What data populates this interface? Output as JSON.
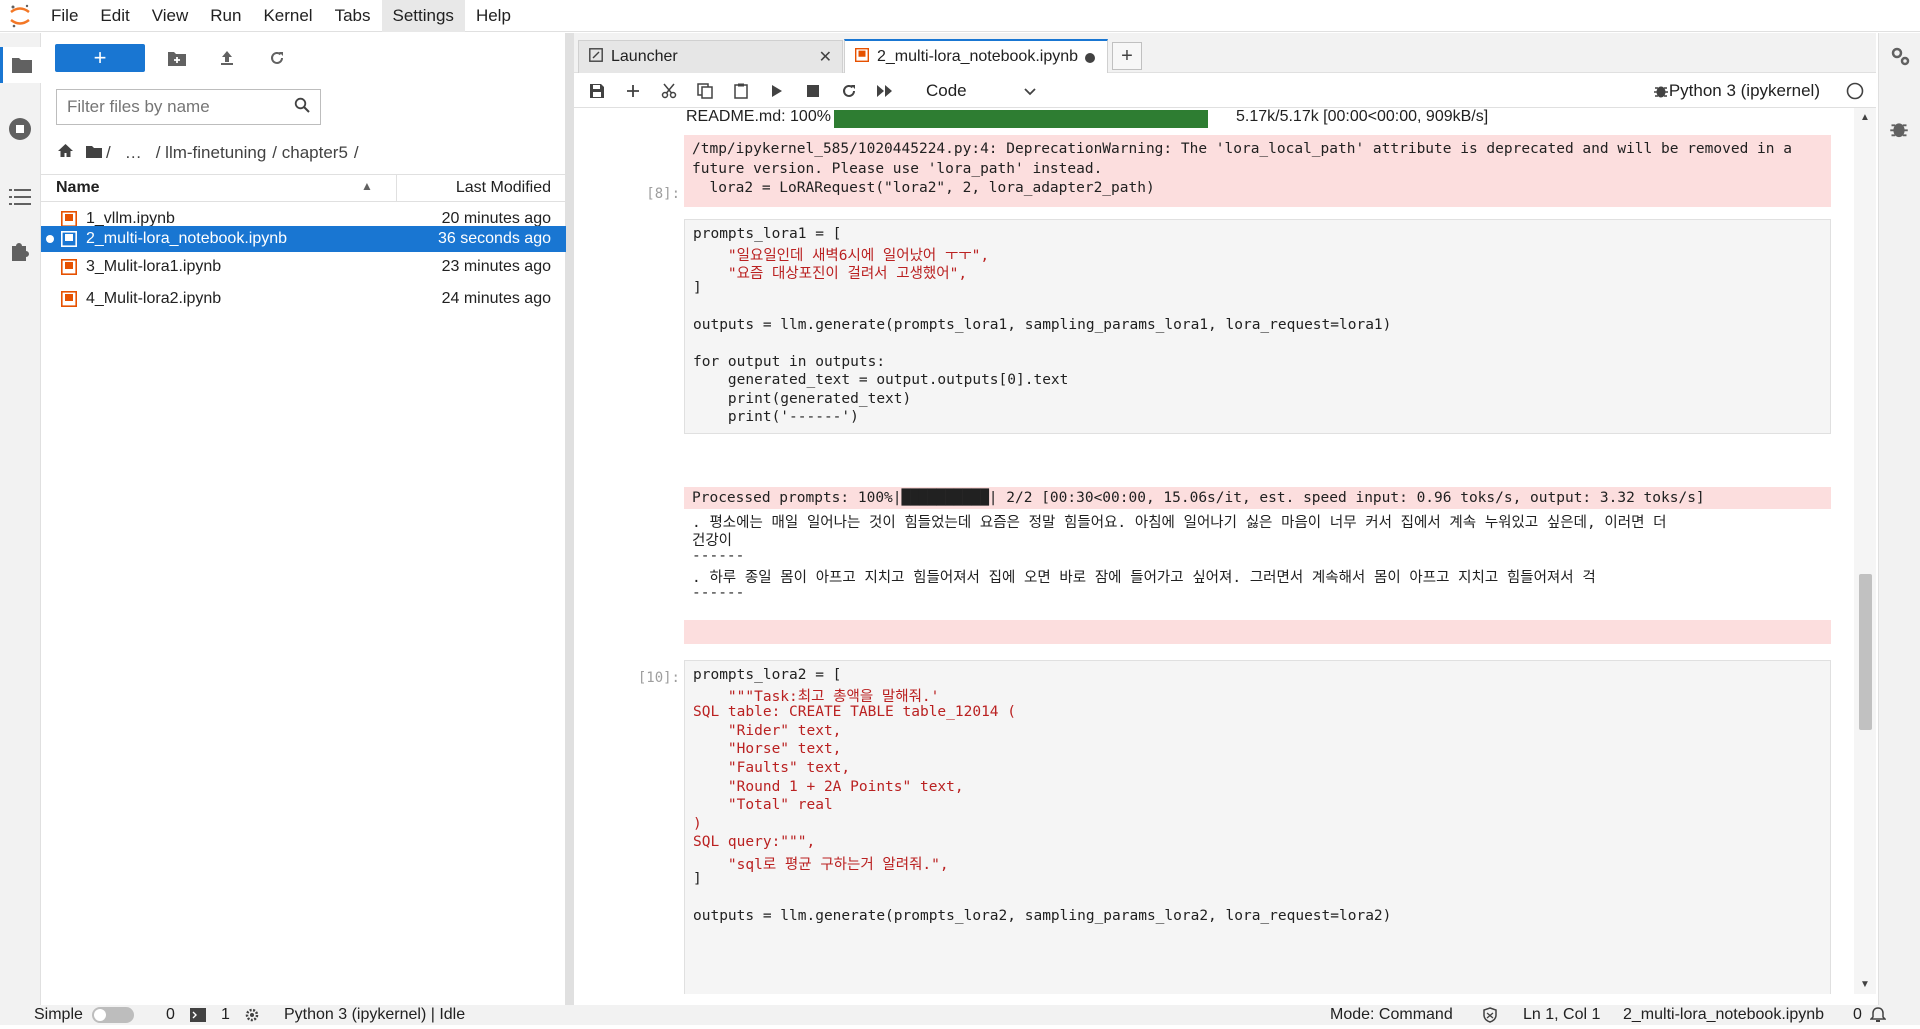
{
  "menubar": {
    "items": [
      "File",
      "Edit",
      "View",
      "Run",
      "Kernel",
      "Tabs",
      "Settings",
      "Help"
    ]
  },
  "filebrowser": {
    "new_button_label": "+",
    "filter_placeholder": "Filter files by name",
    "breadcrumb": [
      "/",
      "…",
      "/ llm-finetuning",
      "/ chapter5",
      "/"
    ],
    "col_name": "Name",
    "col_modified": "Last Modified",
    "files": [
      {
        "name": "1_vllm.ipynb",
        "modified": "20 minutes ago"
      },
      {
        "name": "2_multi-lora_notebook.ipynb",
        "modified": "36 seconds ago"
      },
      {
        "name": "3_Mulit-lora1.ipynb",
        "modified": "23 minutes ago"
      },
      {
        "name": "4_Mulit-lora2.ipynb",
        "modified": "24 minutes ago"
      }
    ]
  },
  "tabs": [
    {
      "label": "Launcher"
    },
    {
      "label": "2_multi-lora_notebook.ipynb"
    }
  ],
  "toolbar": {
    "cell_type": "Code",
    "kernel": "Python 3 (ipykernel)"
  },
  "notebook": {
    "download_line": {
      "left": "README.md: 100%",
      "right": "5.17k/5.17k [00:00<00:00,  909kB/s]"
    },
    "warning_lines": [
      "/tmp/ipykernel_585/1020445224.py:4: DeprecationWarning: The 'lora_local_path' attribute is deprecated and will be removed in a",
      "future version. Please use 'lora_path' instead.",
      "  lora2 = LoRARequest(\"lora2\", 2, lora_adapter2_path)"
    ],
    "cell8": {
      "prompt": "[8]:",
      "lines": [
        "prompts_lora1 = [",
        "    \"일요일인데 새벽6시에 일어났어 ㅜㅜ\",",
        "    \"요즘 대상포진이 걸려서 고생했어\",",
        "]",
        "",
        "outputs = llm.generate(prompts_lora1, sampling_params_lora1, lora_request=lora1)",
        "",
        "for output in outputs:",
        "    generated_text = output.outputs[0].text",
        "    print(generated_text)",
        "    print('------')"
      ]
    },
    "cell8_output": {
      "progress_line": "Processed prompts: 100%|██████████| 2/2 [00:30<00:00, 15.06s/it, est. speed input: 0.96 toks/s, output: 3.32 toks/s]",
      "lines": [
        ". 평소에는 매일 일어나는 것이 힘들었는데 요즘은 정말 힘들어요. 아침에 일어나기 싫은 마음이 너무 커서 집에서 계속 누워있고 싶은데, 이러면 더",
        "건강이",
        "------",
        ". 하루 종일 몸이 아프고 지치고 힘들어져서 집에 오면 바로 잠에 들어가고 싶어져. 그러면서 계속해서 몸이 아프고 지치고 힘들어져서 걱",
        "------"
      ]
    },
    "cell10": {
      "prompt": "[10]:",
      "lines": [
        "prompts_lora2 = [",
        "    \"\"\"Task:최고 총액을 말해줘.'",
        "SQL table: CREATE TABLE table_12014 (",
        "    \"Rider\" text,",
        "    \"Horse\" text,",
        "    \"Faults\" text,",
        "    \"Round 1 + 2A Points\" text,",
        "    \"Total\" real",
        ")",
        "SQL query:\"\"\",",
        "    \"sql로 평균 구하는거 알려줘.\",",
        "]",
        "",
        "outputs = llm.generate(prompts_lora2, sampling_params_lora2, lora_request=lora2)"
      ]
    }
  },
  "statusbar": {
    "mode_label": "Simple",
    "count1": "0",
    "count2": "1",
    "kernel_status": "Python 3 (ipykernel) | Idle",
    "mode": "Mode: Command",
    "cursor": "Ln 1, Col 1",
    "filename": "2_multi-lora_notebook.ipynb",
    "notif_count": "0"
  },
  "colors": {
    "accent": "#1976d2",
    "stderr_bg": "#fcdede",
    "progress_green": "#2e7d32",
    "notebook_icon": "#e65100"
  }
}
